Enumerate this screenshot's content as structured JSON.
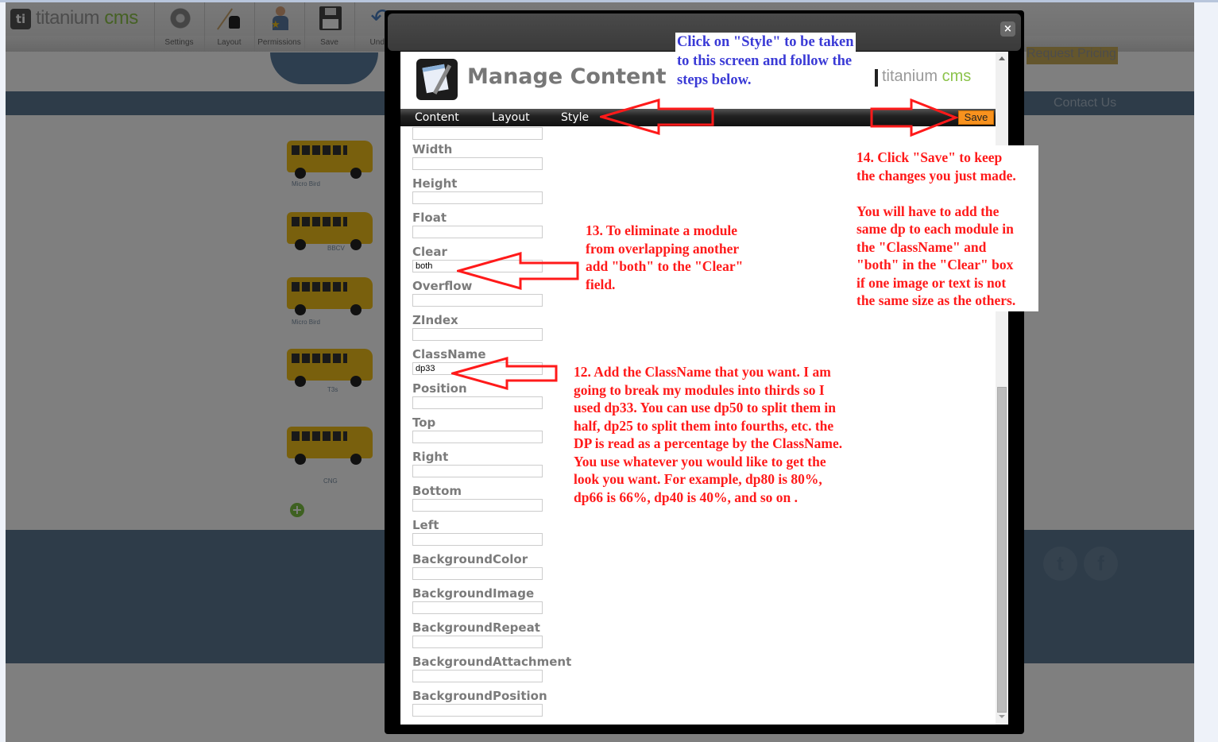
{
  "background_page": {
    "logo": {
      "text_main": "titanium",
      "text_accent": "cms"
    },
    "toolbar": [
      {
        "label": "Settings",
        "icon": "gear-icon"
      },
      {
        "label": "Layout",
        "icon": "ink-brush-icon"
      },
      {
        "label": "Permissions",
        "icon": "user-star-icon"
      },
      {
        "label": "Save",
        "icon": "floppy-disk-icon"
      },
      {
        "label": "Undo",
        "icon": "undo-arrow-icon"
      }
    ],
    "nav": {
      "request_pricing": "Request Pricing",
      "contact_us": "Contact Us"
    },
    "modules": [
      {
        "caption": "Micro Bird"
      },
      {
        "caption": "BBCV"
      },
      {
        "caption": "Micro Bird"
      },
      {
        "caption": "T3s"
      },
      {
        "caption": "CNG"
      }
    ],
    "social": [
      {
        "icon": "twitter-icon",
        "glyph": "t"
      },
      {
        "icon": "facebook-icon",
        "glyph": "f"
      }
    ]
  },
  "modal": {
    "close_glyph": "×",
    "title": "Manage Content",
    "brand": {
      "text_main": "titanium",
      "text_accent": "cms"
    },
    "tabs": [
      {
        "label": "Content"
      },
      {
        "label": "Layout"
      },
      {
        "label": "Style"
      }
    ],
    "save_label": "Save",
    "fields": [
      {
        "label": "",
        "value": ""
      },
      {
        "label": "Width",
        "value": ""
      },
      {
        "label": "Height",
        "value": ""
      },
      {
        "label": "Float",
        "value": ""
      },
      {
        "label": "Clear",
        "value": "both"
      },
      {
        "label": "Overflow",
        "value": ""
      },
      {
        "label": "ZIndex",
        "value": ""
      },
      {
        "label": "ClassName",
        "value": "dp33"
      },
      {
        "label": "Position",
        "value": ""
      },
      {
        "label": "Top",
        "value": ""
      },
      {
        "label": "Right",
        "value": ""
      },
      {
        "label": "Bottom",
        "value": ""
      },
      {
        "label": "Left",
        "value": ""
      },
      {
        "label": "BackgroundColor",
        "value": ""
      },
      {
        "label": "BackgroundImage",
        "value": ""
      },
      {
        "label": "BackgroundRepeat",
        "value": ""
      },
      {
        "label": "BackgroundAttachment",
        "value": ""
      },
      {
        "label": "BackgroundPosition",
        "value": ""
      }
    ]
  },
  "annotations": {
    "style_hint": "Click on \"Style\" to be taken\nto this screen and follow the\nsteps below.",
    "step13": "13. To eliminate a module\nfrom overlapping another\nadd \"both\" to the \"Clear\"\nfield.",
    "step14": "14. Click \"Save\" to keep\nthe changes you just made.\n\nYou will have to add the\nsame dp to each module in\nthe \"ClassName\" and\n\"both\" in the \"Clear\" box\nif one image or text is not\nthe same size as the others.",
    "step12": "12. Add the ClassName that you want. I am\ngoing to break my modules into thirds so I\nused dp33. You can use dp50 to split them in\nhalf, dp25 to split them into fourths, etc. the\nDP is read as a percentage by the ClassName.\nYou use whatever you would like to get the\nlook you want. For example, dp80 is 80%,\ndp66 is 66%, dp40 is 40%, and so on ."
  },
  "colors": {
    "annotation_red": "#ff1a1a",
    "annotation_blue": "#3a3ad6",
    "save_orange": "#f8921e",
    "brand_green": "#8cc34b",
    "site_blue": "#5c7893"
  }
}
